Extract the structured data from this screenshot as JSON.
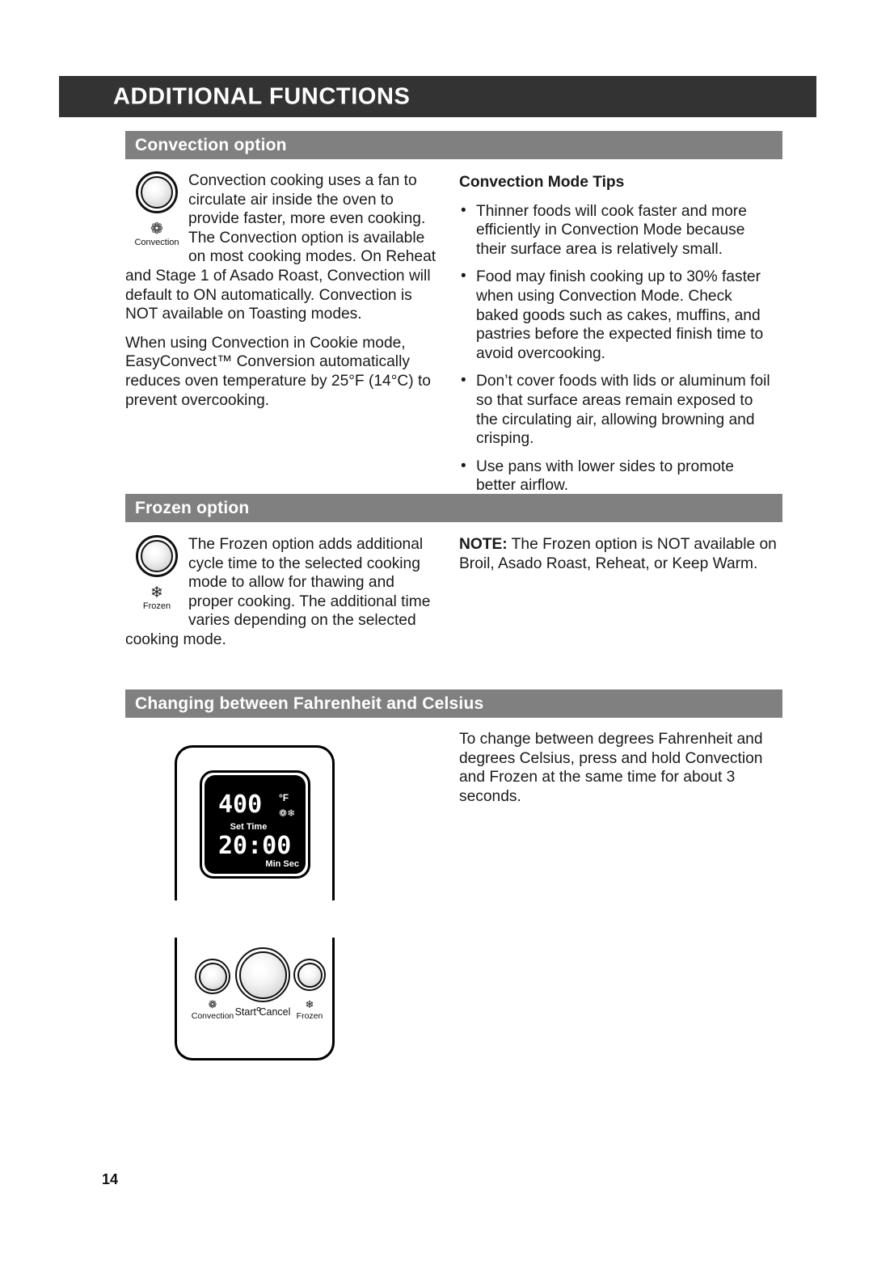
{
  "chapter": {
    "title": "ADDITIONAL FUNCTIONS",
    "bar_color": "#333333"
  },
  "page": {
    "number": "14"
  },
  "sections": {
    "convection": {
      "heading": "Convection option",
      "heading_bar_color": "#808080",
      "knob": {
        "icon_name": "fan-icon",
        "icon_glyph": "❁",
        "caption": "Convection"
      },
      "left_paragraphs": [
        "Convection cooking uses a fan to circulate air inside the oven to provide faster, more even cooking. The Convection option is available on most cooking modes. On Reheat and Stage 1 of Asado Roast, Convection will default to ON automatically. Convection is NOT available on Toasting modes.",
        "When using Convection in Cookie mode, EasyConvect™ Conversion automatically reduces oven temperature by 25°F (14°C) to prevent overcooking."
      ],
      "tips_title": "Convection Mode Tips",
      "tips": [
        "Thinner foods will cook faster and more efficiently in Convection Mode because their surface area is relatively small.",
        "Food may finish cooking up to 30% faster when using Convection Mode. Check baked goods such as cakes, muffins, and pastries before the expected finish time to avoid overcooking.",
        "Don’t cover foods with lids or aluminum foil so that surface areas remain exposed to the circulating air, allowing browning and crisping.",
        "Use pans with lower sides to promote better airflow."
      ],
      "bullet_glyph": "•"
    },
    "frozen": {
      "heading": "Frozen option",
      "knob": {
        "icon_name": "snowflake-icon",
        "icon_glyph": "❄",
        "caption": "Frozen"
      },
      "left_paragraph": "The Frozen option adds additional cycle time to the selected cooking mode to allow for thawing and proper cooking. The additional time varies depending on the selected cooking mode.",
      "note_label": "NOTE:",
      "note_text": " The Frozen option is NOT available on Broil, Asado Roast, Reheat, or Keep Warm."
    },
    "temperature_units": {
      "heading": "Changing between Fahrenheit and Celsius",
      "right_paragraph": "To change between degrees Fahrenheit and degrees Celsius, press and hold Convection and Frozen at the same time for about 3 seconds.",
      "panel": {
        "display": {
          "temperature": "400",
          "unit": "°F",
          "indicator_fan": "❁",
          "indicator_frozen": "❄",
          "set_time_label": "Set Time",
          "time": "20:00",
          "min_sec_label": "Min Sec"
        },
        "buttons": {
          "convection_label": "Convection",
          "convection_glyph": "❁",
          "start_label": "Start",
          "cancel_label": "Cancel",
          "frozen_label": "Frozen",
          "frozen_glyph": "❄"
        }
      }
    }
  }
}
